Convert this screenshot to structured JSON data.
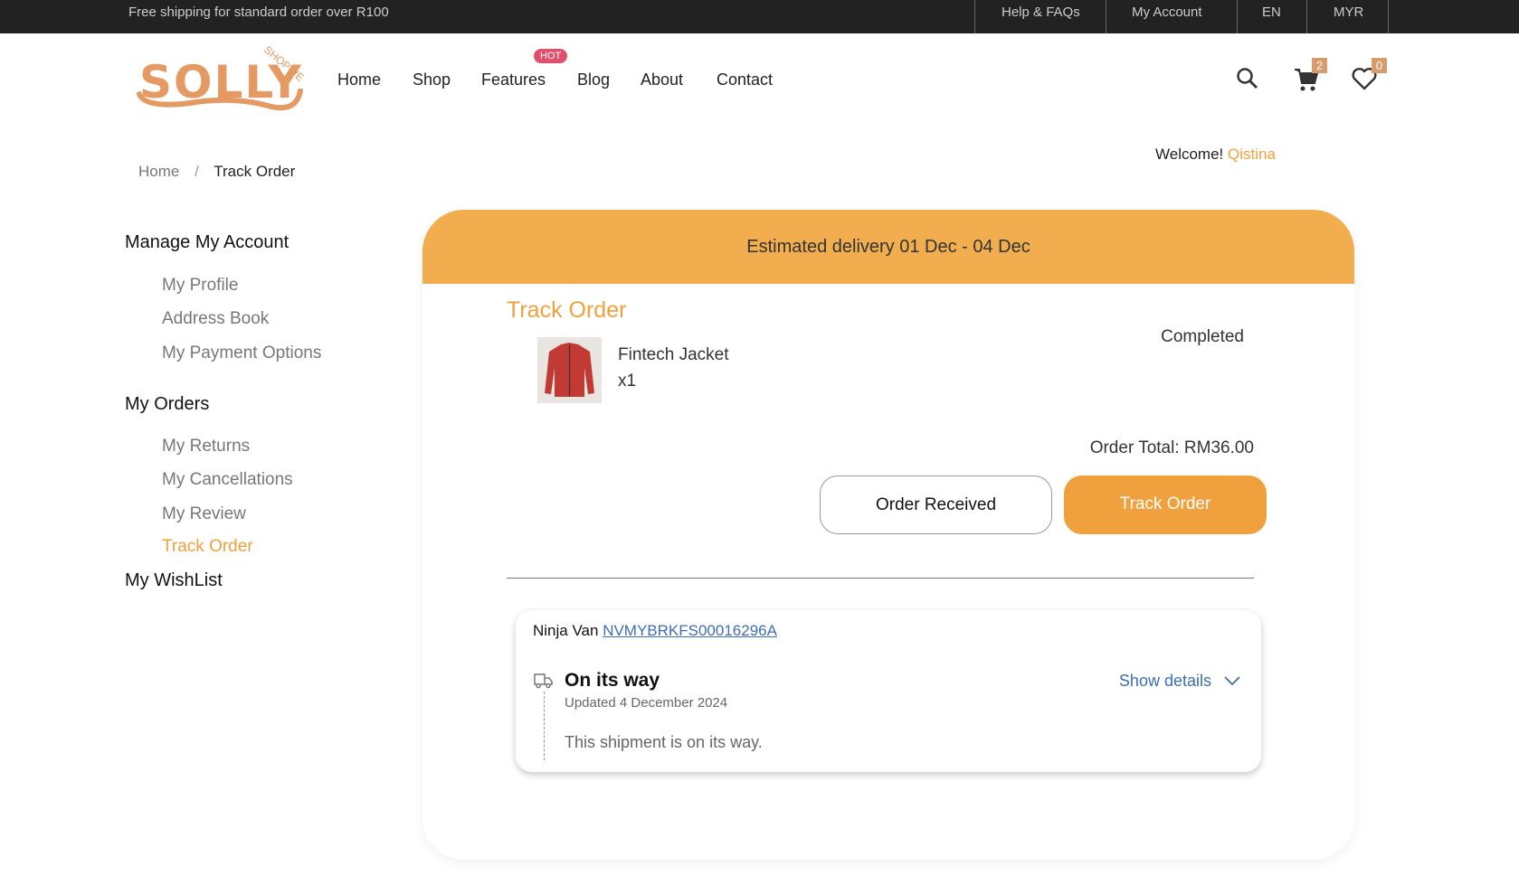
{
  "topbar": {
    "promo": "Free shipping for standard order over R100",
    "links": [
      "Help & FAQs",
      "My Account",
      "EN",
      "MYR"
    ]
  },
  "logo": {
    "text": "SOLLY",
    "sub": "SHOPWE"
  },
  "nav": {
    "items": [
      "Home",
      "Shop",
      "Features",
      "Blog",
      "About",
      "Contact"
    ],
    "hot_badge": "HOT"
  },
  "icons": {
    "cart_count": "2",
    "wishlist_count": "0"
  },
  "welcome": {
    "label": "Welcome!",
    "name": "Qistina"
  },
  "breadcrumb": {
    "home": "Home",
    "sep": "/",
    "current": "Track Order"
  },
  "sidebar": {
    "manage": "Manage My Account",
    "manage_items": [
      "My Profile",
      "Address Book",
      "My Payment Options"
    ],
    "orders": "My Orders",
    "orders_items": [
      "My Returns",
      "My Cancellations",
      "My Review",
      "Track Order"
    ],
    "wishlist": "My WishList"
  },
  "order": {
    "estimated": "Estimated delivery 01 Dec - 04 Dec",
    "title": "Track Order",
    "product": "Fintech Jacket",
    "qty": "x1",
    "status": "Completed",
    "total": "Order Total: RM36.00",
    "btn_received": "Order Received",
    "btn_track": "Track Order"
  },
  "tracking": {
    "carrier": "Ninja Van",
    "number": "NVMYBRKFS00016296A",
    "status": "On its way",
    "updated": "Updated 4 December 2024",
    "details_link": "Show details",
    "message": "This shipment is on its way."
  },
  "colors": {
    "accent": "#f0a13d",
    "band": "#f2ae4e",
    "link": "#3d6db5"
  }
}
